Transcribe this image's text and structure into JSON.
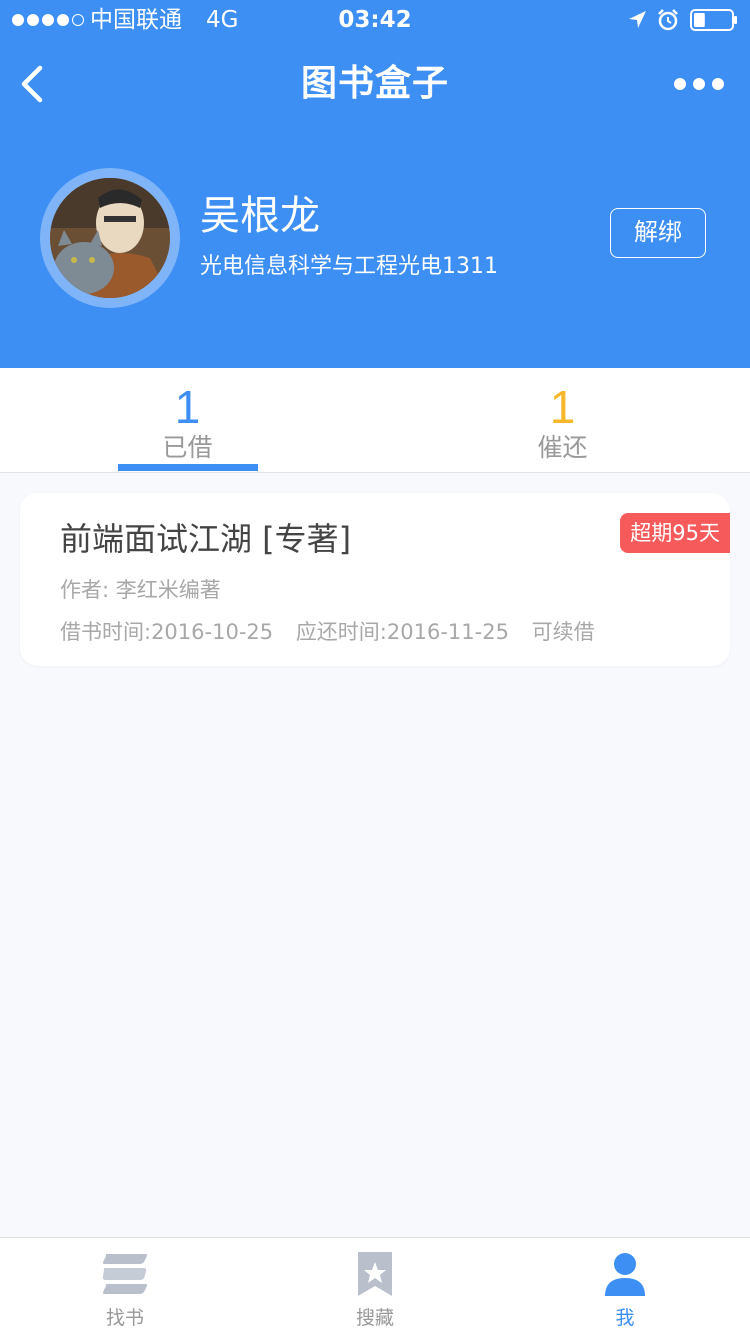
{
  "status_bar": {
    "carrier": "中国联通",
    "network": "4G",
    "time": "03:42",
    "signal_bars": 4,
    "signal_total": 5,
    "battery_level": 0.3
  },
  "nav": {
    "title": "图书盒子",
    "back_icon": "chevron-left-icon",
    "more_icon": "more-horizontal-icon"
  },
  "profile": {
    "name": "吴根龙",
    "major": "光电信息科学与工程光电1311",
    "unbind_label": "解绑"
  },
  "tabs": [
    {
      "count": "1",
      "label": "已借",
      "active": true
    },
    {
      "count": "1",
      "label": "催还",
      "active": false
    }
  ],
  "books": [
    {
      "title": "前端面试江湖 [专著]",
      "overdue": "超期95天",
      "author": "作者: 李红米编著",
      "borrow_date": "借书时间:2016-10-25",
      "due_date": "应还时间:2016-11-25",
      "renew": "可续借"
    }
  ],
  "tabbar": [
    {
      "label": "找书",
      "icon": "book-stack-icon",
      "active": false
    },
    {
      "label": "搜藏",
      "icon": "bookmark-star-icon",
      "active": false
    },
    {
      "label": "我",
      "icon": "person-icon",
      "active": true
    }
  ],
  "colors": {
    "primary": "#3d8ff4",
    "accent_yellow": "#f6b72b",
    "overdue_red": "#f65a5a",
    "inactive_gray": "#999999"
  }
}
